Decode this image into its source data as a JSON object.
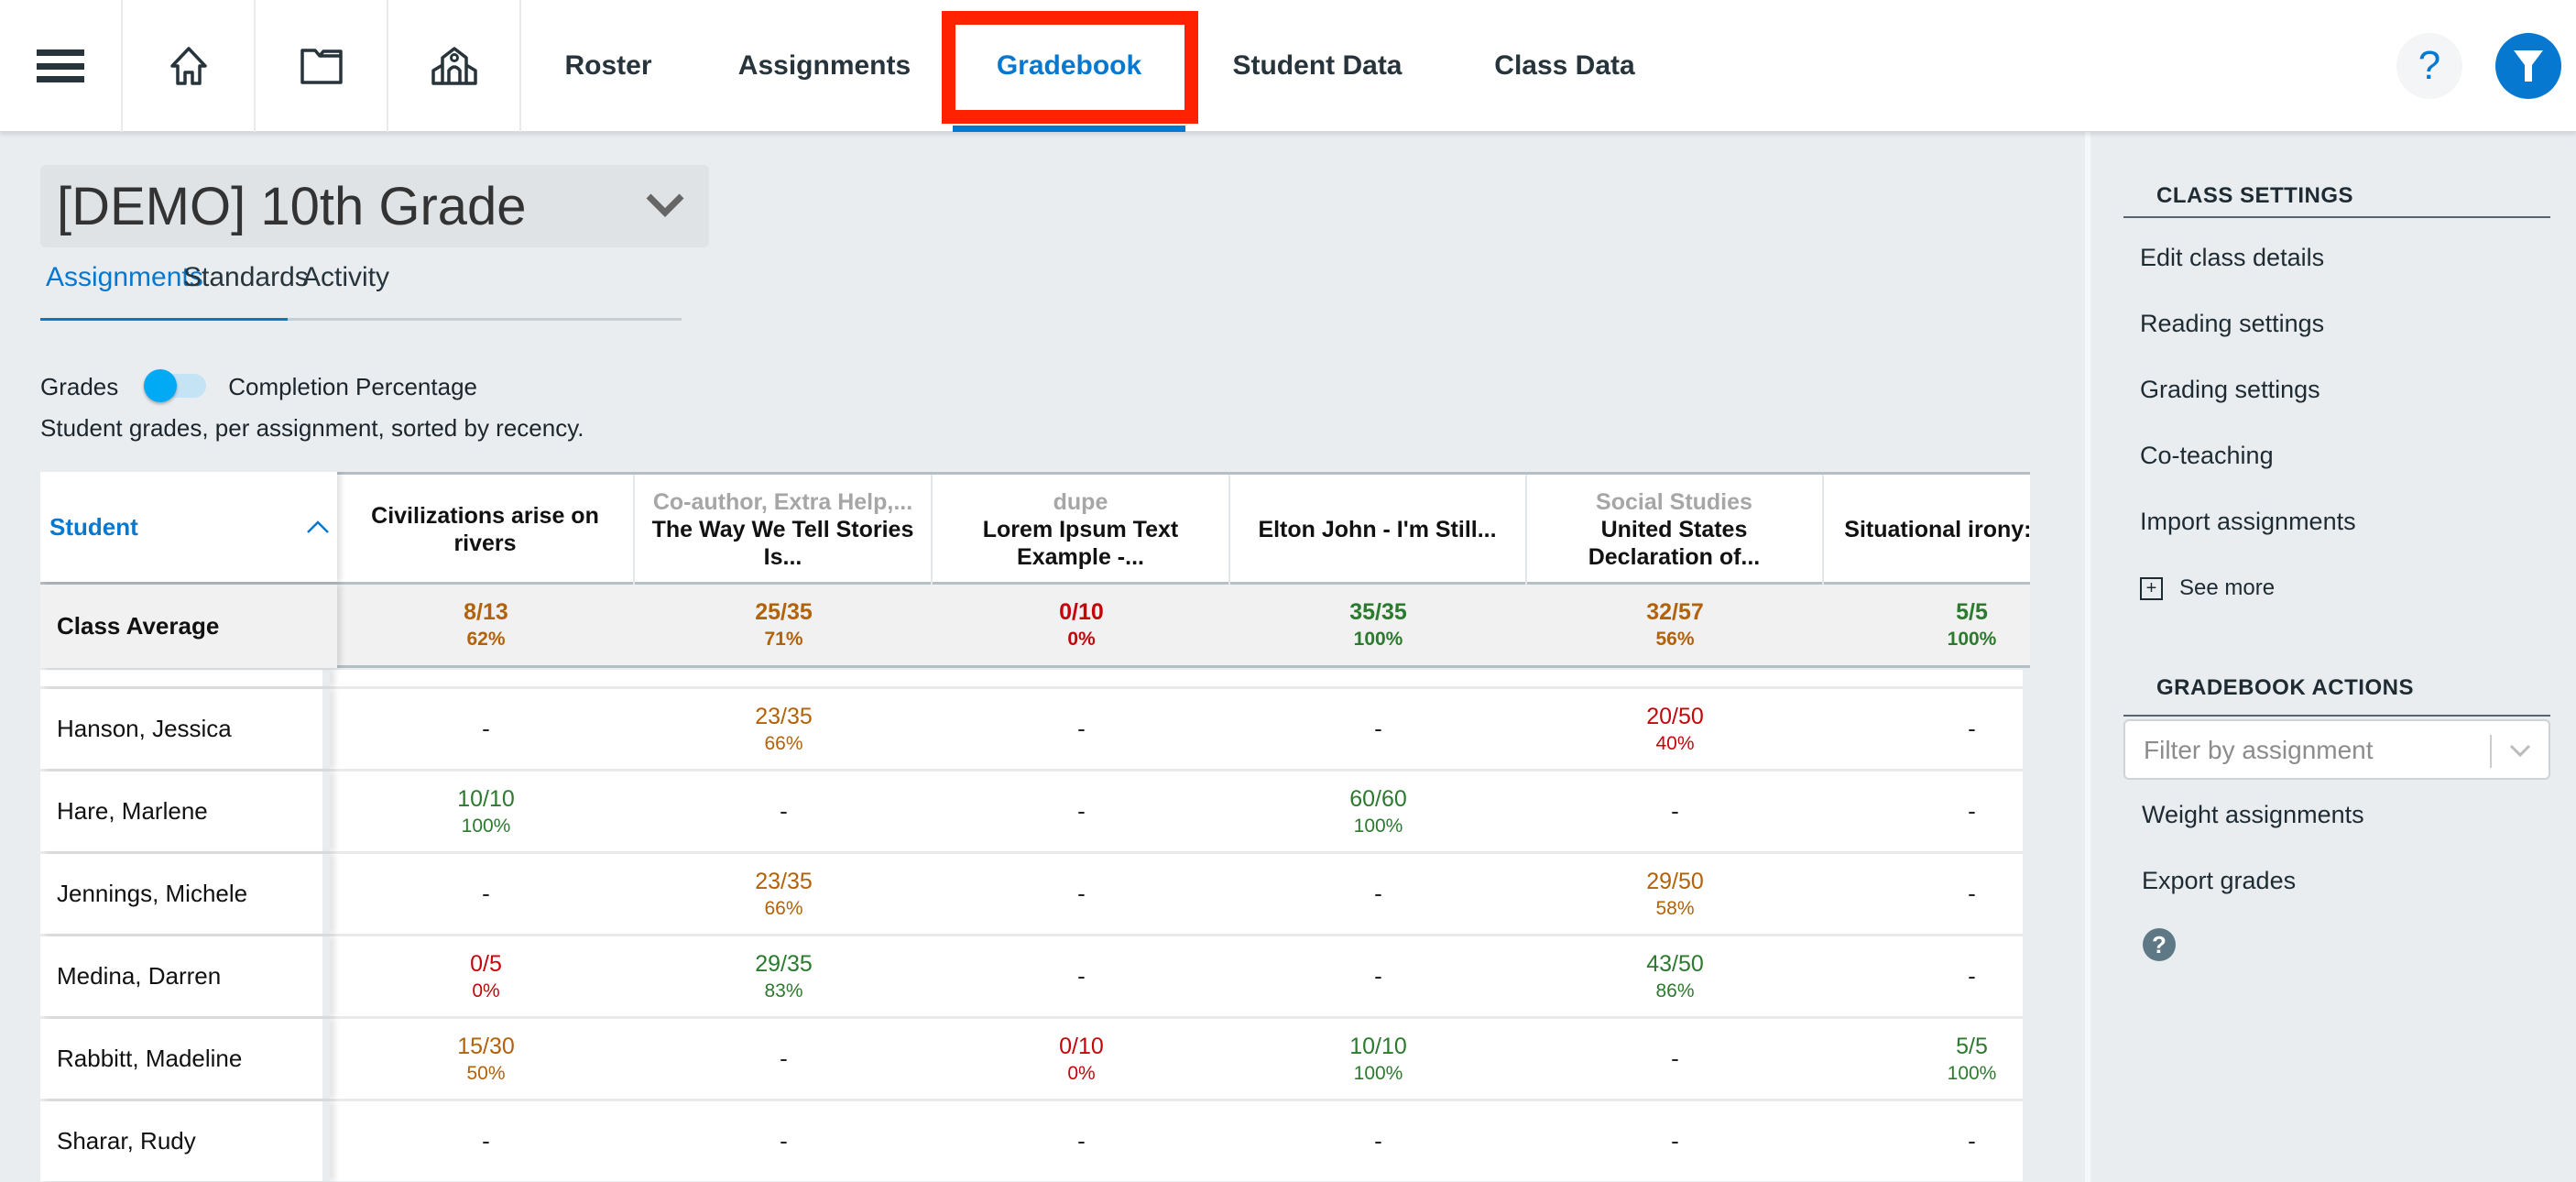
{
  "nav": {
    "icons": [
      "menu-icon",
      "home-icon",
      "folder-icon",
      "school-icon"
    ],
    "tabs": [
      {
        "label": "Roster",
        "active": false
      },
      {
        "label": "Assignments",
        "active": false
      },
      {
        "label": "Gradebook",
        "active": true
      },
      {
        "label": "Student Data",
        "active": false
      },
      {
        "label": "Class Data",
        "active": false
      }
    ],
    "help_label": "?",
    "accent": "#0778cf",
    "highlight_color": "#ff2200"
  },
  "class_selector": {
    "value": "[DEMO] 10th Grade"
  },
  "subtabs": [
    {
      "label": "Assignments",
      "active": true
    },
    {
      "label": "Standards",
      "active": false
    },
    {
      "label": "Activity",
      "active": false
    }
  ],
  "toggle": {
    "left_label": "Grades",
    "right_label": "Completion Percentage",
    "state": "Grades"
  },
  "description": "Student grades, per assignment, sorted by recency.",
  "table": {
    "student_header": "Student",
    "class_average_label": "Class Average",
    "columns": [
      {
        "category": "",
        "title": "Civilizations arise on rivers"
      },
      {
        "category": "Co-author, Extra Help,...",
        "title": "The Way We Tell Stories Is..."
      },
      {
        "category": "dupe",
        "title": "Lorem Ipsum Text Example -..."
      },
      {
        "category": "",
        "title": "Elton John - I'm Still..."
      },
      {
        "category": "Social Studies",
        "title": "United States Declaration of..."
      },
      {
        "category": "",
        "title": "Situational irony: The..."
      }
    ],
    "class_average": [
      {
        "score": "8/13",
        "pct": "62%",
        "status": "orange"
      },
      {
        "score": "25/35",
        "pct": "71%",
        "status": "orange"
      },
      {
        "score": "0/10",
        "pct": "0%",
        "status": "red"
      },
      {
        "score": "35/35",
        "pct": "100%",
        "status": "green"
      },
      {
        "score": "32/57",
        "pct": "56%",
        "status": "orange"
      },
      {
        "score": "5/5",
        "pct": "100%",
        "status": "green"
      }
    ],
    "rows": [
      {
        "name": "Hanson, Jessica",
        "cells": [
          {
            "score": "-"
          },
          {
            "score": "23/35",
            "pct": "66%",
            "status": "orange"
          },
          {
            "score": "-"
          },
          {
            "score": "-"
          },
          {
            "score": "20/50",
            "pct": "40%",
            "status": "red"
          },
          {
            "score": "-"
          }
        ]
      },
      {
        "name": "Hare, Marlene",
        "cells": [
          {
            "score": "10/10",
            "pct": "100%",
            "status": "green"
          },
          {
            "score": "-"
          },
          {
            "score": "-"
          },
          {
            "score": "60/60",
            "pct": "100%",
            "status": "green"
          },
          {
            "score": "-"
          },
          {
            "score": "-"
          }
        ]
      },
      {
        "name": "Jennings, Michele",
        "cells": [
          {
            "score": "-"
          },
          {
            "score": "23/35",
            "pct": "66%",
            "status": "orange"
          },
          {
            "score": "-"
          },
          {
            "score": "-"
          },
          {
            "score": "29/50",
            "pct": "58%",
            "status": "orange"
          },
          {
            "score": "-"
          }
        ]
      },
      {
        "name": "Medina, Darren",
        "cells": [
          {
            "score": "0/5",
            "pct": "0%",
            "status": "red"
          },
          {
            "score": "29/35",
            "pct": "83%",
            "status": "green"
          },
          {
            "score": "-"
          },
          {
            "score": "-"
          },
          {
            "score": "43/50",
            "pct": "86%",
            "status": "green"
          },
          {
            "score": "-"
          }
        ]
      },
      {
        "name": "Rabbitt, Madeline",
        "cells": [
          {
            "score": "15/30",
            "pct": "50%",
            "status": "orange"
          },
          {
            "score": "-"
          },
          {
            "score": "0/10",
            "pct": "0%",
            "status": "red"
          },
          {
            "score": "10/10",
            "pct": "100%",
            "status": "green"
          },
          {
            "score": "-"
          },
          {
            "score": "5/5",
            "pct": "100%",
            "status": "green"
          }
        ]
      },
      {
        "name": "Sharar, Rudy",
        "cells": [
          {
            "score": "-"
          },
          {
            "score": "-"
          },
          {
            "score": "-"
          },
          {
            "score": "-"
          },
          {
            "score": "-"
          },
          {
            "score": "-"
          }
        ]
      }
    ],
    "status_colors": {
      "red": "#c5050c",
      "orange": "#b1620a",
      "green": "#2b7a2e"
    }
  },
  "sidebar": {
    "class_settings": {
      "heading": "CLASS SETTINGS",
      "items": [
        "Edit class details",
        "Reading settings",
        "Grading settings",
        "Co-teaching",
        "Import assignments"
      ],
      "see_more": "See more"
    },
    "gradebook_actions": {
      "heading": "GRADEBOOK ACTIONS",
      "filter_placeholder": "Filter by assignment",
      "items": [
        "Weight assignments",
        "Export grades"
      ],
      "help_label": "?"
    }
  }
}
